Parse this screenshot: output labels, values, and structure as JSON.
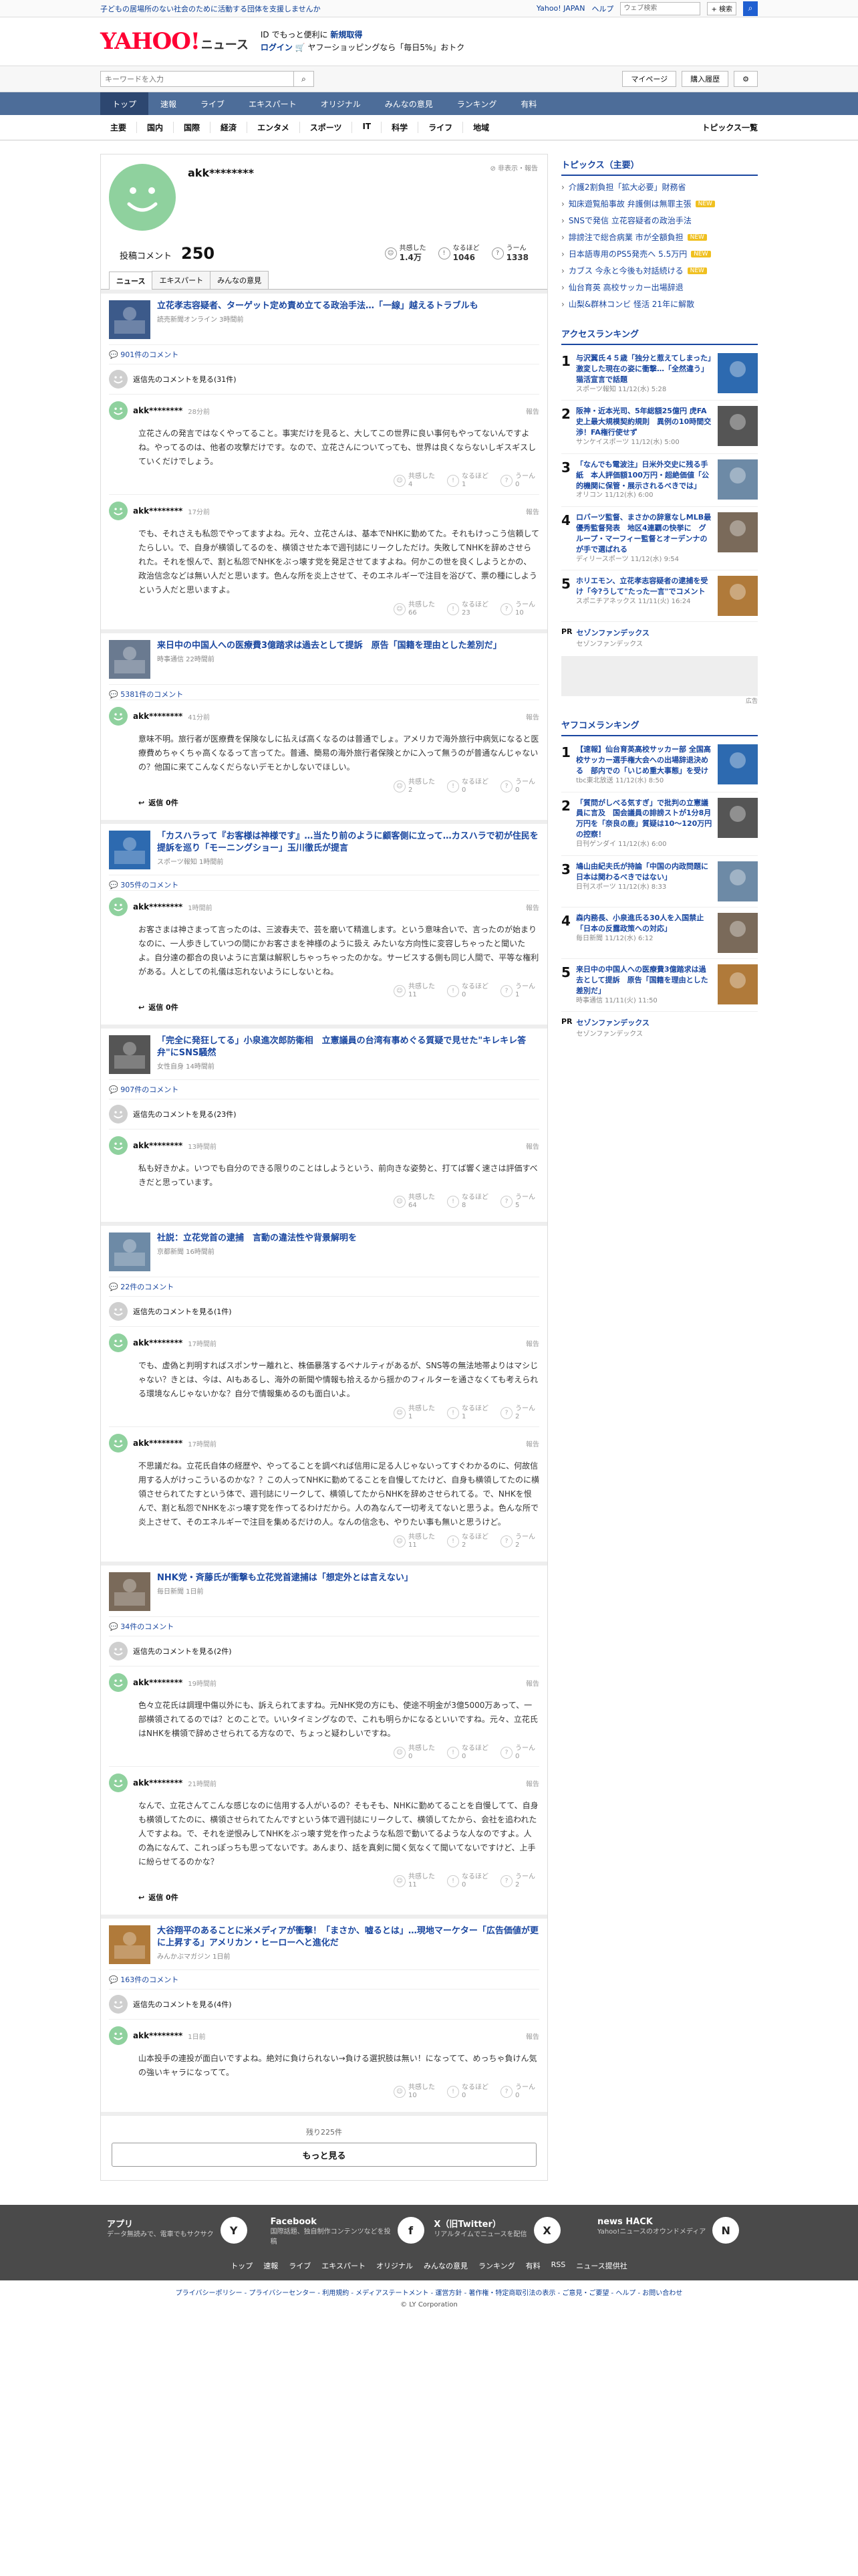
{
  "topstrip": {
    "banner": "子どもの居場所のない社会のために活動する団体を支援しませんか",
    "links": [
      "Yahoo! JAPAN",
      "ヘルプ"
    ],
    "search_placeholder": "ウェブ検索",
    "search_btn": "+ 検索"
  },
  "logo": {
    "yahoo": "YAHOO!",
    "japan": "JAPAN",
    "news": "ニュース"
  },
  "promo": {
    "line1_a": "ID でもっと便利に",
    "line1_b": "新規取得",
    "line2_a": "ログイン",
    "line2_b": "ヤフーショッピングなら「毎日5%」おトク"
  },
  "search": {
    "placeholder": "キーワードを入力",
    "mypage": "マイページ",
    "history": "購入履歴"
  },
  "mainnav": [
    "トップ",
    "速報",
    "ライブ",
    "エキスパート",
    "オリジナル",
    "みんなの意見",
    "ランキング",
    "有料"
  ],
  "subnav": {
    "items": [
      "主要",
      "国内",
      "国際",
      "経済",
      "エンタメ",
      "スポーツ",
      "IT",
      "科学",
      "ライフ",
      "地域"
    ],
    "topics_list": "トピックス一覧"
  },
  "profile": {
    "name": "akk********",
    "report": "非表示・報告",
    "comments_label": "投稿コメント",
    "comments_count": "250",
    "kyokan_label": "共感した",
    "kyokan": "1.4万",
    "naruhodo_label": "なるほど",
    "naruhodo": "1046",
    "uun_label": "うーん",
    "uun": "1338"
  },
  "tabs": [
    "ニュース",
    "エキスパート",
    "みんなの意見"
  ],
  "labels": {
    "kyokan": "共感した",
    "naruhodo": "なるほど",
    "uun": "うーん",
    "report": "報告",
    "reply": "返信",
    "reply_zero": "返信 0件"
  },
  "articles": [
    {
      "title": "立花孝志容疑者、ターゲット定め責め立てる政治手法…「一線」越えるトラブルも",
      "source": "読売新聞オンライン 3時間前",
      "count": "901件のコメント",
      "replies_link": "返信先のコメントを見る(31件)",
      "comments": [
        {
          "name": "akk********",
          "time": "28分前",
          "body": "立花さんの発言ではなくやってること。事実だけを見ると、大してこの世界に良い事何もやってないんですよね。やってるのは、他者の攻撃だけです。なので、立花さんについてっても、世界は良くならないしギスギスしていくだけでしょう。",
          "k": "4",
          "n": "1",
          "u": "0",
          "reply": false
        },
        {
          "name": "akk********",
          "time": "17分前",
          "body": "でも、それさえも私怨でやってますよね。元々、立花さんは、基本でNHKに勤めてた。それもけっこう信頼してたらしい。で、自身が横領してるのを、横領させた本で週刊誌にリークしただけ。失敗してNHKを辞めさせられた。それを恨んで、割と私怨でNHKをぶっ壊す党を発足させてますよね。何かこの世を良くしようとかの、政治信念などは無い人だと思います。色んな所を炎上させて、そのエネルギーで注目を浴びて、票の種にしようという人だと思いますよ。",
          "k": "66",
          "n": "23",
          "u": "10",
          "reply": false
        }
      ]
    },
    {
      "title": "来日中の中国人への医療費3億踏求は過去として提訴　原告「国籍を理由とした差別だ」",
      "source": "時事通信 22時間前",
      "count": "5381件のコメント",
      "replies_link": "",
      "comments": [
        {
          "name": "akk********",
          "time": "41分前",
          "body": "意味不明。旅行者が医療費を保険なしに払えば高くなるのは普通でしょ。アメリカで海外旅行中病気になると医療費めちゃくちゃ高くなるって言ってた。普通、簡易の海外旅行者保険とかに入って無うのが普通なんじゃないの？他国に来てこんなくだらないデモとかしないでほしい。",
          "k": "2",
          "n": "0",
          "u": "0",
          "reply": true
        }
      ]
    },
    {
      "title": "「カスハラって『お客様は神様です』…当たり前のように顧客側に立って…カスハラで初が住民を提訴を巡り「モーニングショー」玉川徹氏が提言",
      "source": "スポーツ報知 1時間前",
      "count": "305件のコメント",
      "replies_link": "",
      "comments": [
        {
          "name": "akk********",
          "time": "1時間前",
          "body": "お客さまは神さまって言ったのは、三波春夫で、芸を磨いて精進します。という意味合いで、言ったのが始まりなのに、一人歩きしていつの間にかお客さまを神様のように扱え みたいな方向性に変容しちゃったと聞いたよ。自分達の都合の良いように言葉は解釈しちゃっちゃったのかな。サービスする側も同じ人間で、平等な権利がある。人としての礼儀は忘れないようにしないとね。",
          "k": "11",
          "n": "0",
          "u": "1",
          "reply": true
        }
      ]
    },
    {
      "title": "「完全に発狂してる」小泉進次郎防衛相　立憲議員の台湾有事めぐる質疑で見せた\"キレキレ答弁\"にSNS騒然",
      "source": "女性自身 14時間前",
      "count": "907件のコメント",
      "replies_link": "返信先のコメントを見る(23件)",
      "comments": [
        {
          "name": "akk********",
          "time": "13時間前",
          "body": "私も好きかよ。いつでも自分のできる限りのことはしようという、前向きな姿勢と、打てば響く速さは評価すべきだと思っています。",
          "k": "64",
          "n": "8",
          "u": "5",
          "reply": false
        }
      ]
    },
    {
      "title": "社説：立花党首の逮捕　言動の違法性や背景解明を",
      "source": "京都新聞 16時間前",
      "count": "22件のコメント",
      "replies_link": "返信先のコメントを見る(1件)",
      "comments": [
        {
          "name": "akk********",
          "time": "17時間前",
          "body": "でも、虚偽と判明すればスポンサー離れと、株価暴落するペナルティがあるが、SNS等の無法地帯よりはマシじゃない？きとは、今は、AIもあるし、海外の新聞や情報も拾えるから揺かのフィルターを通さなくても考えられる環境なんじゃないかな？自分で情報集めるのも面白いよ。",
          "k": "1",
          "n": "1",
          "u": "2",
          "reply": false
        },
        {
          "name": "akk********",
          "time": "17時間前",
          "body": "不思議だね。立花氏自体の経歴や、やってることを調べれば信用に足る人じゃないってすぐわかるのに、何故信用する人がけっこういるのかな？？この人ってNHKに勤めてることを自慢してたけど、自身も横領してたのに横領させられてたすという体で、週刊誌にリークして、横領してたからNHKを辞めさせられてる。で、NHKを恨んで、割と私怨でNHKをぶっ壊す党を作ってるわけだから。人の為なんて一切考えてないと思うよ。色んな所で炎上させて、そのエネルギーで注目を集めるだけの人。なんの信念も、やりたい事も無いと思うけど。",
          "k": "11",
          "n": "2",
          "u": "2",
          "reply": false
        }
      ]
    },
    {
      "title": "NHK党・斉藤氏が衝撃も立花党首逮捕は「想定外とは言えない」",
      "source": "毎日新聞 1日前",
      "count": "34件のコメント",
      "replies_link": "返信先のコメントを見る(2件)",
      "comments": [
        {
          "name": "akk********",
          "time": "19時間前",
          "body": "色々立花氏は調理中傷以外にも、訴えられてますね。元NHK党の方にも、使途不明金が3億5000万あって、一部横領されてるのでは？とのことで。いいタイミングなので、これも明らかになるといいですね。元々、立花氏はNHKを横領で辞めさせられてる方なので、ちょっと疑わしいですね。",
          "k": "0",
          "n": "0",
          "u": "0",
          "reply": false
        },
        {
          "name": "akk********",
          "time": "21時間前",
          "body": "なんで、立花さんてこんな感じなのに信用する人がいるの？そもそも、NHKに勤めてることを自慢してて、自身も横領してたのに、横領させられてたんですという体で週刊誌にリークして、横領してたから、会社を追われた人ですよね。で、それを逆恨みしてNHKをぶっ壊す党を作ったような私怨で動いてるような人なのですよ。人の為になんて、これっぽっちも思ってないです。あんまり、話を真剣に聞く気なくて聞いてないですけど、上手に紛らせてるのかな？",
          "k": "11",
          "n": "0",
          "u": "2",
          "reply": true
        }
      ]
    },
    {
      "title": "大谷翔平のあることに米メディアが衝撃！「まさか、嘘るとは」…現地マーケター「広告価値が更に上昇する」アメリカン・ヒーローへと進化だ",
      "source": "みんかぶマガジン 1日前",
      "count": "163件のコメント",
      "replies_link": "返信先のコメントを見る(4件)",
      "comments": [
        {
          "name": "akk********",
          "time": "1日前",
          "body": "山本投手の連投が面白いですよね。絶対に負けられない→負ける選択肢は無い！になってて、めっちゃ負けん気の強いキャラになってて。",
          "k": "10",
          "n": "0",
          "u": "0",
          "reply": false
        }
      ]
    }
  ],
  "more": {
    "remaining": "残り225件",
    "button": "もっと見る"
  },
  "side": {
    "topics_title": "トピックス（主要）",
    "topics": [
      {
        "t": "介護2割負担「拡大必要」財務省",
        "b": ""
      },
      {
        "t": "知床遊覧船事故 弁護側は無罪主張",
        "b": "NEW"
      },
      {
        "t": "SNSで発信 立花容疑者の政治手法",
        "b": ""
      },
      {
        "t": "誹謗注で総合病業 市が全額負担",
        "b": "NEW"
      },
      {
        "t": "日本語専用のPS5発売へ 5.5万円",
        "b": "NEW"
      },
      {
        "t": "カブス 今永と今後も対話続ける",
        "b": "NEW"
      },
      {
        "t": "仙台育英 高校サッカー出場辞退",
        "b": ""
      },
      {
        "t": "山梨&群林コンビ 怪活 21年に解散",
        "b": ""
      }
    ],
    "access_title": "アクセスランキング",
    "access": [
      {
        "no": "1",
        "t": "与沢翼氏４５歳「独分と惹えてしまった」激変した現在の姿に衝撃…「全然違う」猫活宣言で話題",
        "s": "スポーツ報知 11/12(水) 5:28"
      },
      {
        "no": "2",
        "t": "阪神・近本光司、5年総額25億円 虎FA史上最大規模契約規則　異例の10時間交渉！FA権行使せず",
        "s": "サンケイスポーツ 11/12(水) 5:00"
      },
      {
        "no": "3",
        "t": "「なんでも電波注」日米外交史に残る手紙　本人評価額100万円・超絶価値「公的機関に保管・展示されるべきでは」",
        "s": "オリコン 11/12(水) 6:00"
      },
      {
        "no": "4",
        "t": "ロバーツ監督、まさかの辞意なしMLB最優秀監督発表　地区4連覇の快挙に　グループ・マーフィー監督とオーデンナのが手で選ばれる",
        "s": "ディリースポーツ 11/12(水) 9:54"
      },
      {
        "no": "5",
        "t": "ホリエモン、立花孝志容疑者の逮捕を受け「今?うして\"たった一言\"でコメント",
        "s": "スポニチアネックス 11/11(火) 16:24"
      }
    ],
    "pr1": {
      "label": "PR",
      "t": "セゾンファンデックス",
      "s": "セゾンファンデックス"
    },
    "adlabel": "広告",
    "yafuko_title": "ヤフコメランキング",
    "yafuko": [
      {
        "no": "1",
        "t": "【速報】仙台育英高校サッカー部 全国高校サッカー選手権大会への出場辞退決める　部内での「いじめ重大事態」を受け",
        "s": "tbc東北放送 11/12(水) 8:50"
      },
      {
        "no": "2",
        "t": "「質問がしべる気すぎ」で批判の立憲議員に言及　国会議員の誹謗ストが1分8月万円を「奈良の鹿」質疑は10～120万円の控察！",
        "s": "日刊ゲンダイ 11/12(水) 6:00"
      },
      {
        "no": "3",
        "t": "鳩山由紀夫氏が持論「中国の内政問題に日本は関わるべきではない」",
        "s": "日刊スポーツ 11/12(水) 8:33"
      },
      {
        "no": "4",
        "t": "森内務長、小泉進氏る30人を入国禁止　「日本の反露政策への対応」",
        "s": "毎日新聞 11/12(水) 6:12"
      },
      {
        "no": "5",
        "t": "来日中の中国人への医療費3億踏求は過去として提訴　原告「国籍を理由とした差別だ」",
        "s": "時事通信 11/11(火) 11:50"
      }
    ],
    "pr2": {
      "label": "PR",
      "t": "セゾンファンデックス",
      "s": "セゾンファンデックス"
    }
  },
  "footer": {
    "cards": [
      {
        "t": "アプリ",
        "d": "データ無読みで、電車でもサクサク",
        "i": "Y"
      },
      {
        "t": "Facebook",
        "d": "国際話題、独自制作コンテンツなどを投稿",
        "i": "f"
      },
      {
        "t": "X（旧Twitter）",
        "d": "リアルタイムでニュースを配信",
        "i": "X"
      },
      {
        "t": "news HACK",
        "d": "Yahoo!ニュースのオウンドメディア",
        "i": "N"
      }
    ],
    "links": [
      "トップ",
      "速報",
      "ライブ",
      "エキスパート",
      "オリジナル",
      "みんなの意見",
      "ランキング",
      "有料",
      "RSS",
      "ニュース提供社"
    ],
    "bottom": "プライバシーポリシー - プライバシーセンター - 利用規約 - メディアステートメント - 運営方針 - 著作権・特定商取引法の表示 - ご意見・ご要望 - ヘルプ - お問い合わせ",
    "copy": "© LY Corporation"
  }
}
